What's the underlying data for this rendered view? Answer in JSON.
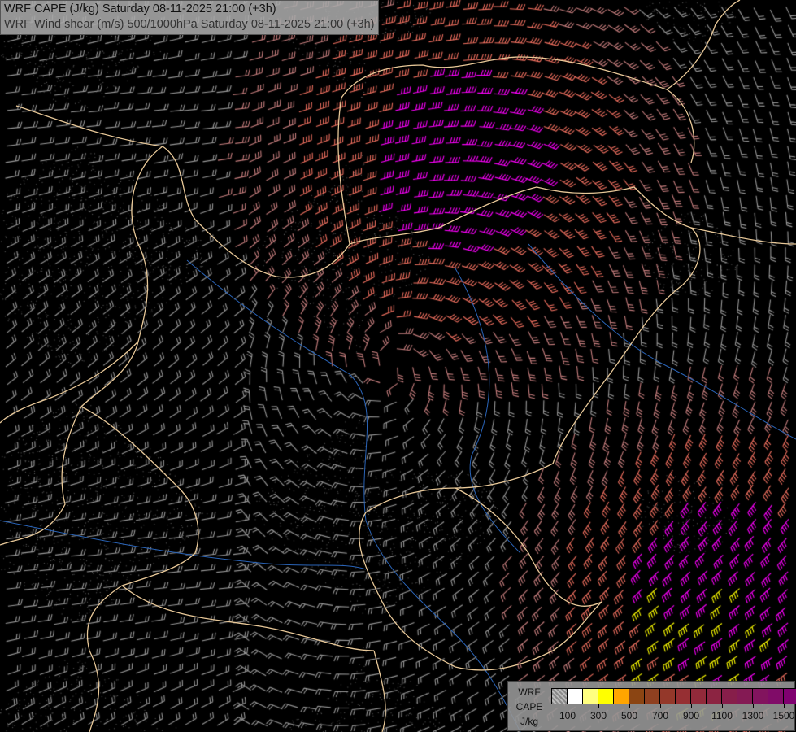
{
  "title": {
    "line1": "WRF CAPE (J/kg) Saturday 08-11-2025 21:00 (+3h)",
    "line2": "WRF Wind shear (m/s) 500/1000hPa Saturday 08-11-2025 21:00 (+3h)"
  },
  "legend": {
    "label_line1": "WRF",
    "label_line2": "CAPE",
    "label_line3": "J/kg",
    "colors": [
      "hatch",
      "#ffffff",
      "#ffff80",
      "#ffff00",
      "#ffa500",
      "#8b4513",
      "#8f4020",
      "#94382a",
      "#962f33",
      "#922a3a",
      "#8c2442",
      "#871e4a",
      "#841a54",
      "#82145e",
      "#800c68",
      "#800070"
    ],
    "ticks": [
      "100",
      "300",
      "500",
      "700",
      "900",
      "1100",
      "1300",
      "1500"
    ]
  },
  "colors": {
    "background": "#000000",
    "border": "#e8c898",
    "river": "#2a64b8",
    "barb_low": "#9a9a9a",
    "barb_mid": "#c87f7f",
    "barb_high": "#f07060",
    "barb_strong": "#ff00ff",
    "barb_extreme": "#ffff00"
  }
}
